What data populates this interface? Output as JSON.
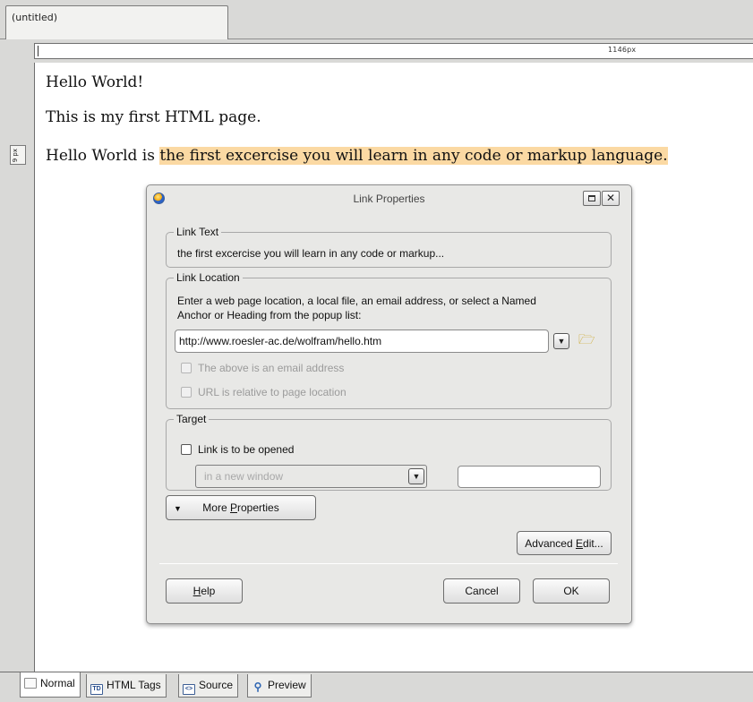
{
  "document_tab": {
    "title": "(untitled)"
  },
  "ruler": {
    "horizontal_label": "1146px",
    "vertical_label": "9 px"
  },
  "editor": {
    "line1": "Hello World!",
    "line2": "This is my first HTML page.",
    "line3_plain": "Hello World is ",
    "line3_selected": "the first excercise you will learn in any code or markup language."
  },
  "dialog": {
    "title": "Link Properties",
    "link_text": {
      "legend": "Link Text",
      "value": "the first excercise you will learn in any code or markup..."
    },
    "link_location": {
      "legend": "Link Location",
      "instructions_line1": "Enter a web page location, a local file, an email address, or select a Named",
      "instructions_line2": "Anchor or Heading from the popup list:",
      "url_value": "http://www.roesler-ac.de/wolfram/hello.htm",
      "email_checkbox": "The above is an email address",
      "relative_checkbox": "URL is relative to page location"
    },
    "target": {
      "legend": "Target",
      "open_checkbox": "Link is to be opened",
      "window_option": "in a new window",
      "frame_value": ""
    },
    "buttons": {
      "more_properties_pre": "More ",
      "more_properties_u": "P",
      "more_properties_post": "roperties",
      "advanced_pre": "Advanced ",
      "advanced_u": "E",
      "advanced_post": "dit...",
      "help_u": "H",
      "help_post": "elp",
      "cancel": "Cancel",
      "ok": "OK"
    }
  },
  "mode_tabs": [
    {
      "label": "Normal",
      "icon": "document-icon"
    },
    {
      "label": "HTML Tags",
      "icon": "html-tags-icon"
    },
    {
      "label": "Source",
      "icon": "source-icon"
    },
    {
      "label": "Preview",
      "icon": "preview-magnifier-icon"
    }
  ]
}
